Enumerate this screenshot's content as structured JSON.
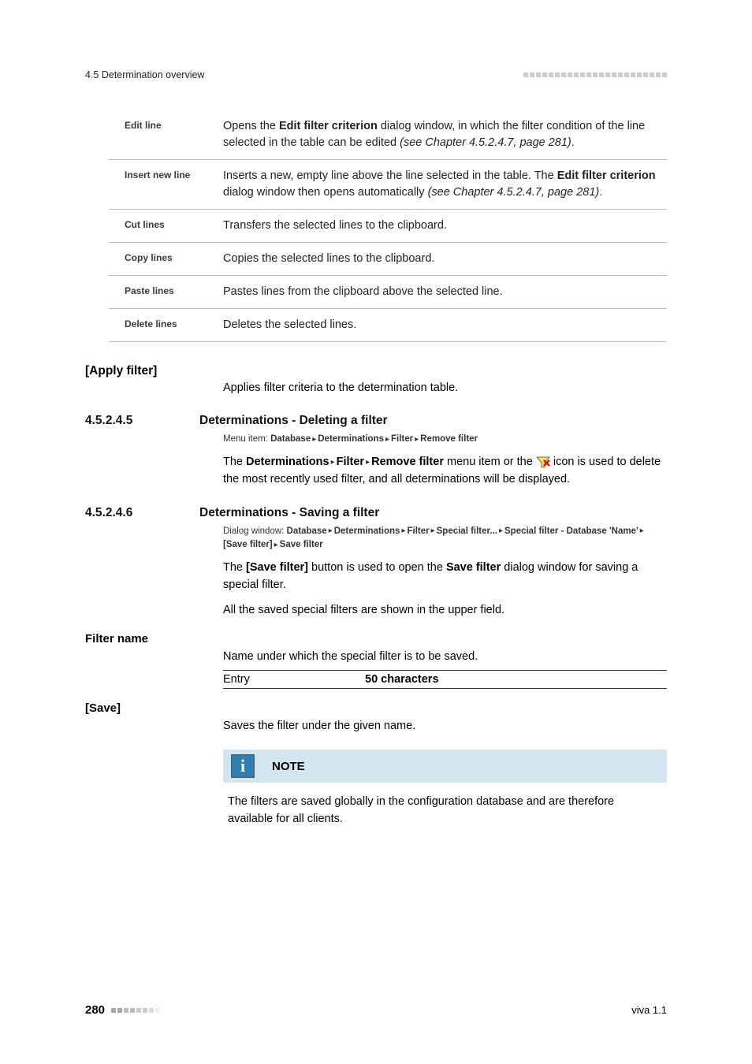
{
  "header": {
    "left": "4.5 Determination overview"
  },
  "table": {
    "rows": [
      {
        "label": "Edit line",
        "desc_pre": "Opens the ",
        "desc_bold": "Edit filter criterion",
        "desc_mid": " dialog window, in which the filter condition of the line selected in the table can be edited ",
        "desc_ref": "(see Chapter 4.5.2.4.7, page 281)",
        "desc_post": "."
      },
      {
        "label": "Insert new line",
        "desc_pre": "Inserts a new, empty line above the line selected in the table. The ",
        "desc_bold": "Edit filter criterion",
        "desc_mid": " dialog window then opens automatically ",
        "desc_ref": "(see Chapter 4.5.2.4.7, page 281)",
        "desc_post": "."
      },
      {
        "label": "Cut lines",
        "desc_plain": "Transfers the selected lines to the clipboard."
      },
      {
        "label": "Copy lines",
        "desc_plain": "Copies the selected lines to the clipboard."
      },
      {
        "label": "Paste lines",
        "desc_plain": "Pastes lines from the clipboard above the selected line."
      },
      {
        "label": "Delete lines",
        "desc_plain": "Deletes the selected lines."
      }
    ]
  },
  "apply_filter": {
    "label": "[Apply filter]",
    "body": "Applies filter criteria to the determination table."
  },
  "sec_delete": {
    "num": "4.5.2.4.5",
    "title": "Determinations - Deleting a filter",
    "menu_prefix": "Menu item: ",
    "menu_parts": [
      "Database",
      "Determinations",
      "Filter",
      "Remove filter"
    ],
    "p_pre": "The ",
    "p_bold_parts": [
      "Determinations",
      "Filter",
      "Remove filter"
    ],
    "p_mid": " menu item or the ",
    "p_post": " icon is used to delete the most recently used filter, and all determinations will be displayed."
  },
  "sec_save": {
    "num": "4.5.2.4.6",
    "title": "Determinations - Saving a filter",
    "menu_prefix": "Dialog window: ",
    "menu_parts": [
      "Database",
      "Determinations",
      "Filter",
      "Special filter...",
      "Special filter - Database 'Name'",
      "[Save filter]",
      "Save filter"
    ],
    "p1_pre": "The ",
    "p1_b1": "[Save filter]",
    "p1_mid": " button is used to open the ",
    "p1_b2": "Save filter",
    "p1_post": " dialog window for saving a special filter.",
    "p2": "All the saved special filters are shown in the upper field."
  },
  "filter_name": {
    "label": "Filter name",
    "body": "Name under which the special filter is to be saved.",
    "entry_label": "Entry",
    "entry_value": "50 characters"
  },
  "save": {
    "label": "[Save]",
    "body": "Saves the filter under the given name."
  },
  "note": {
    "title": "NOTE",
    "body": "The filters are saved globally in the configuration database and are therefore available for all clients."
  },
  "footer": {
    "page": "280",
    "right": "viva 1.1"
  }
}
